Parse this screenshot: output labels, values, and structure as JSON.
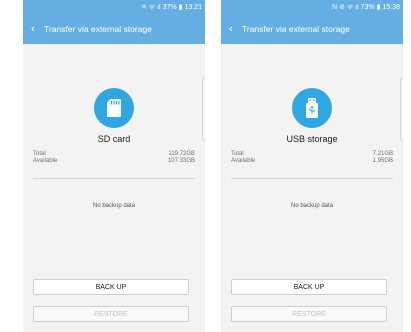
{
  "screens": [
    {
      "status_icons": "✕ ᯤ ıl",
      "battery": "37%",
      "time": "13:21",
      "title": "Transfer via external storage",
      "device_name": "SD card",
      "icon": "sd-card-icon",
      "total_label": "Total",
      "total_value": "119.72GB",
      "available_label": "Available",
      "available_value": "107.33GB",
      "no_backup": "No backup data",
      "backup_button": "BACK UP",
      "restore_button": "RESTORE"
    },
    {
      "status_icons": "N ⊘ ᯤ ıl",
      "battery": "73%",
      "time": "15:38",
      "title": "Transfer via external storage",
      "device_name": "USB storage",
      "icon": "usb-storage-icon",
      "total_label": "Total",
      "total_value": "7.21GB",
      "available_label": "Available",
      "available_value": "1.95GB",
      "no_backup": "No backup data",
      "backup_button": "BACK UP",
      "restore_button": "RESTORE"
    }
  ],
  "colors": {
    "header": "#65aee4",
    "icon_circle": "#2fa7e2",
    "background": "#f3f3f3"
  }
}
